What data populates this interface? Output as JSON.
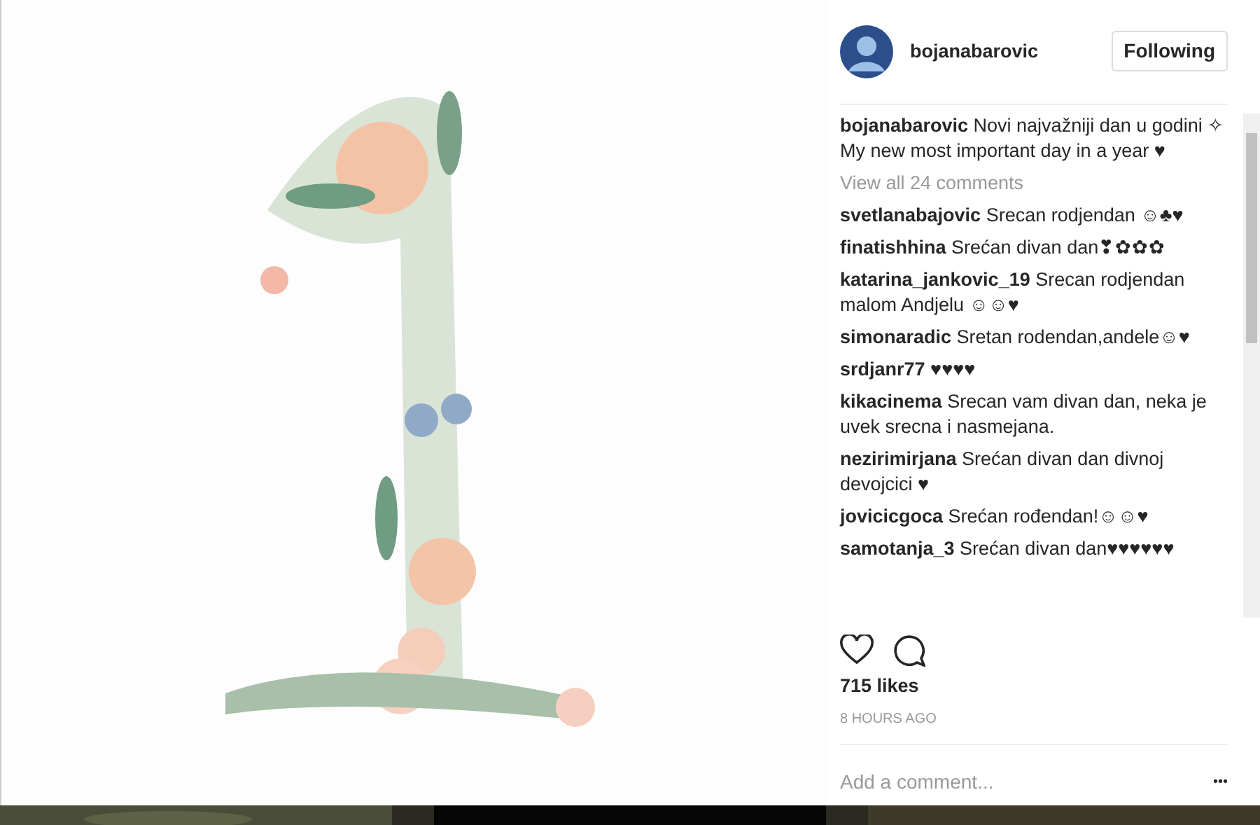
{
  "post": {
    "username": "bojanabarovic",
    "follow_button": "Following"
  },
  "caption": {
    "user": "bojanabarovic",
    "text": "Novi najvažniji dan u godini ✧ My new most important day in a year ♥"
  },
  "view_all": "View all 24 comments",
  "comments": [
    {
      "user": "svetlanabajovic",
      "text": "Srecan rodjendan ☺♣♥"
    },
    {
      "user": "finatishhina",
      "text": "Srećan divan dan❣✿✿✿"
    },
    {
      "user": "katarina_jankovic_19",
      "text": "Srecan rodjendan malom Andjelu ☺☺♥"
    },
    {
      "user": "simonaradic",
      "text": "Sretan rodendan,andele☺♥"
    },
    {
      "user": "srdjanr77",
      "text": "♥♥♥♥"
    },
    {
      "user": "kikacinema",
      "text": "Srecan vam divan dan, neka je uvek srecna i nasmejana."
    },
    {
      "user": "nezirimirjana",
      "text": "Srećan divan dan divnoj devojcici ♥"
    },
    {
      "user": "jovicicgoca",
      "text": "Srećan rođendan!☺☺♥"
    },
    {
      "user": "samotanja_3",
      "text": "Srećan divan dan♥♥♥♥♥♥"
    }
  ],
  "likes": "715 likes",
  "time": "8 HOURS AGO",
  "comment_field": {
    "placeholder": "Add a comment..."
  },
  "more_button": "•••"
}
